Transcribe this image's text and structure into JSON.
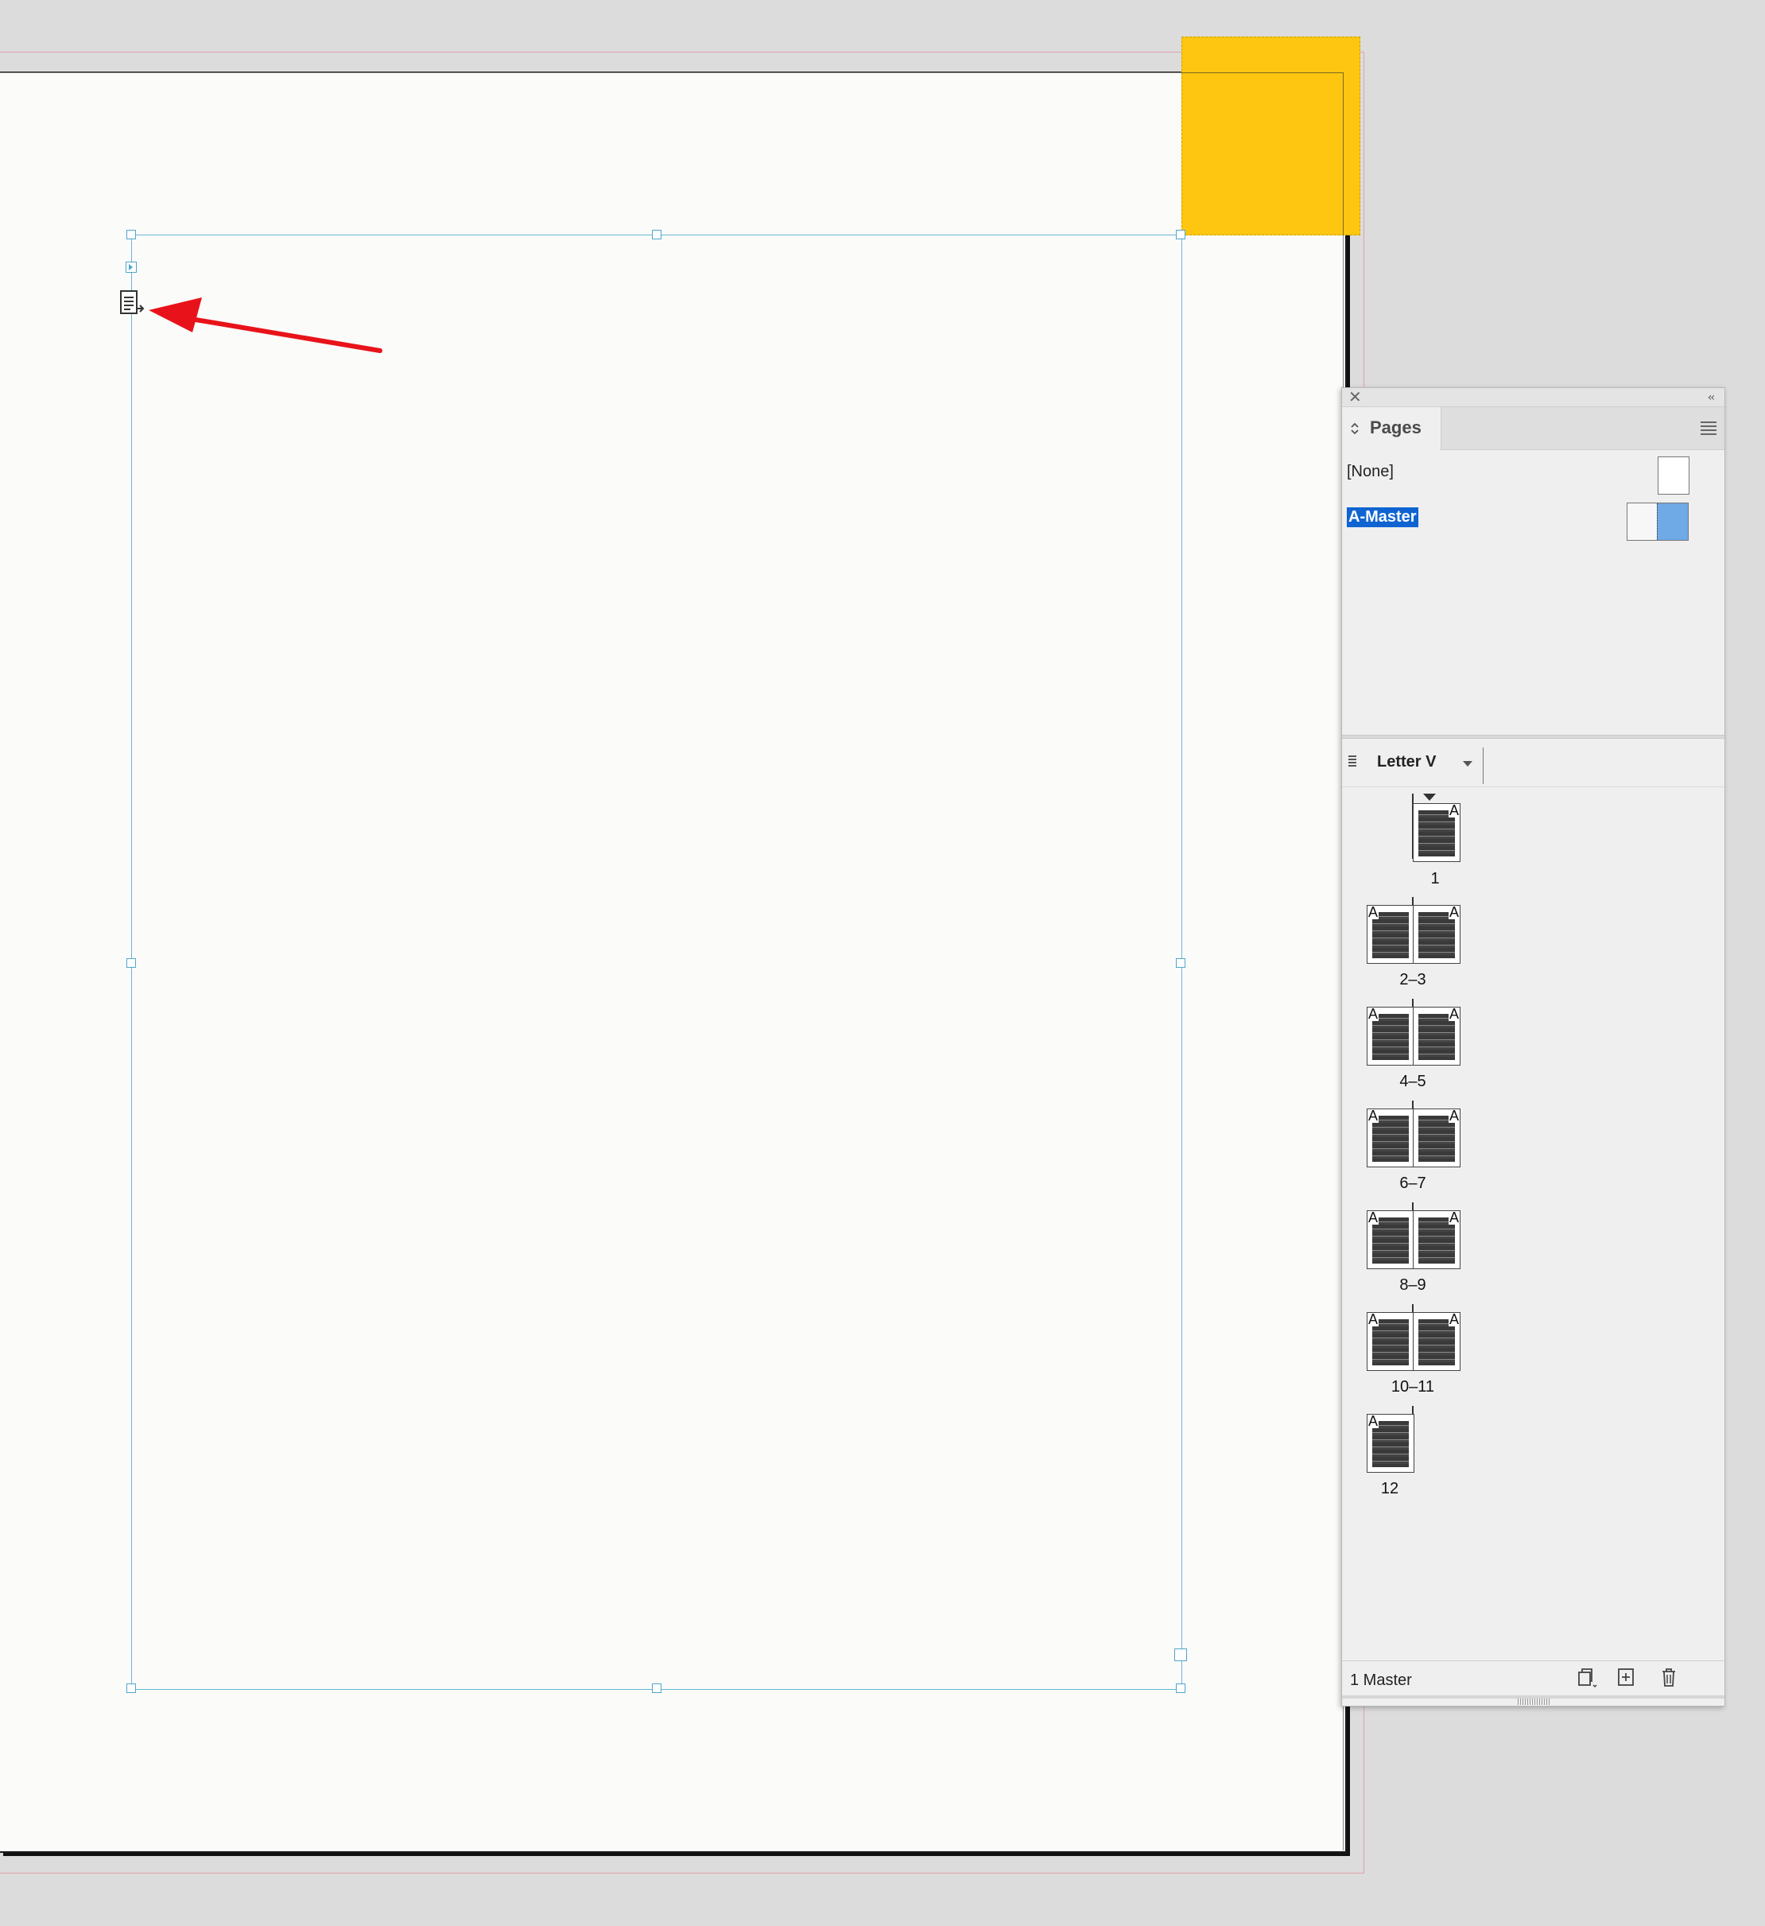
{
  "pages_panel": {
    "tab_label": "Pages",
    "close_glyph": "✕",
    "collapse_glyph": "‹‹",
    "masters": [
      {
        "label": "[None]"
      },
      {
        "label": "A-Master",
        "selected": true,
        "highlight_color": "#0f64d2"
      }
    ],
    "page_size_label": "Letter V",
    "pages": [
      {
        "label": "1",
        "master_letters": [
          "A"
        ]
      },
      {
        "label": "2–3",
        "master_letters": [
          "A",
          "A"
        ]
      },
      {
        "label": "4–5",
        "master_letters": [
          "A",
          "A"
        ]
      },
      {
        "label": "6–7",
        "master_letters": [
          "A",
          "A"
        ]
      },
      {
        "label": "8–9",
        "master_letters": [
          "A",
          "A"
        ]
      },
      {
        "label": "10–11",
        "master_letters": [
          "A",
          "A"
        ]
      },
      {
        "label": "12",
        "master_letters": [
          "A"
        ]
      }
    ],
    "footer_label": "1 Master",
    "footer_buttons": [
      "edit-page-size-icon",
      "new-page-icon",
      "trash-icon"
    ]
  },
  "canvas": {
    "colored_block_color": "#fec611",
    "frame_color": "#6ab8d6",
    "annotation_arrow_color": "#e8131a",
    "icons": [
      "in-port-icon",
      "text-threading-out-port-icon",
      "annotation-arrow-icon"
    ]
  }
}
